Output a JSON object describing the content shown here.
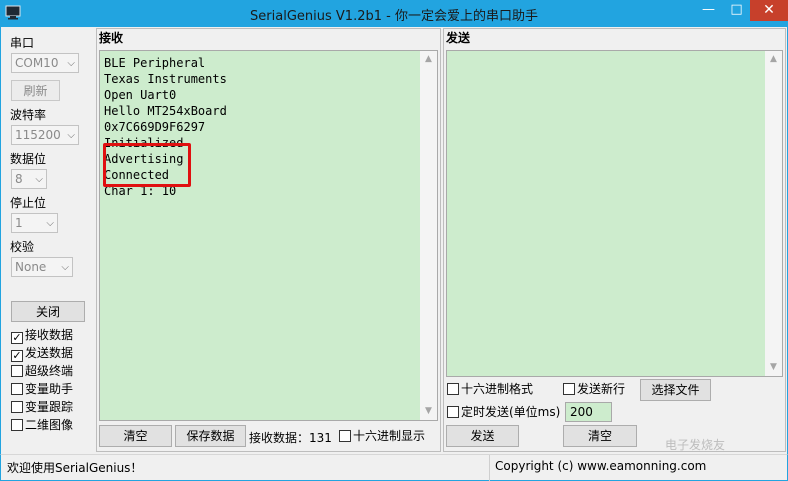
{
  "window": {
    "title": "SerialGenius V1.2b1 - 你一定会爱上的串口助手",
    "minimize_glyph": "—",
    "maximize_glyph": "□",
    "close_glyph": "✕"
  },
  "sidebar": {
    "port_label": "串口",
    "port_value": "COM10",
    "refresh_label": "刷新",
    "baud_label": "波特率",
    "baud_value": "115200",
    "databits_label": "数据位",
    "databits_value": "8",
    "stopbits_label": "停止位",
    "stopbits_value": "1",
    "parity_label": "校验",
    "parity_value": "None",
    "close_label": "关闭",
    "options": [
      {
        "label": "接收数据",
        "checked": true
      },
      {
        "label": "发送数据",
        "checked": true
      },
      {
        "label": "超级终端",
        "checked": false
      },
      {
        "label": "变量助手",
        "checked": false
      },
      {
        "label": "变量跟踪",
        "checked": false
      },
      {
        "label": "二维图像",
        "checked": false
      }
    ]
  },
  "receive": {
    "title": "接收",
    "text": "BLE Peripheral\nTexas Instruments\nOpen Uart0\nHello MT254xBoard\n0x7C669D9F6297\nInitialized\nAdvertising\nConnected\nChar 1: 10",
    "clear_label": "清空",
    "save_label": "保存数据",
    "count_text": "接收数据：131",
    "hex_display_label": "十六进制显示"
  },
  "send": {
    "title": "发送",
    "hex_format_label": "十六进制格式",
    "newline_label": "发送新行",
    "choose_file_label": "选择文件",
    "timed_send_label": "定时发送(单位ms)",
    "interval_value": "200",
    "send_label": "发送",
    "clear_label": "清空"
  },
  "status": {
    "left": "欢迎使用SerialGenius！",
    "right": "Copyright (c) www.eamonning.com"
  },
  "watermark": "电子发烧友",
  "colors": {
    "titlebar": "#22a4e0",
    "textarea_bg": "#cdeccd",
    "highlight": "#e01010",
    "close_button": "#c7402b"
  },
  "icons": {
    "app": "serial-terminal-icon",
    "dropdown": "chevron-down-icon",
    "scroll_up": "arrow-up-icon",
    "scroll_down": "arrow-down-icon",
    "check": "checkmark-icon"
  }
}
